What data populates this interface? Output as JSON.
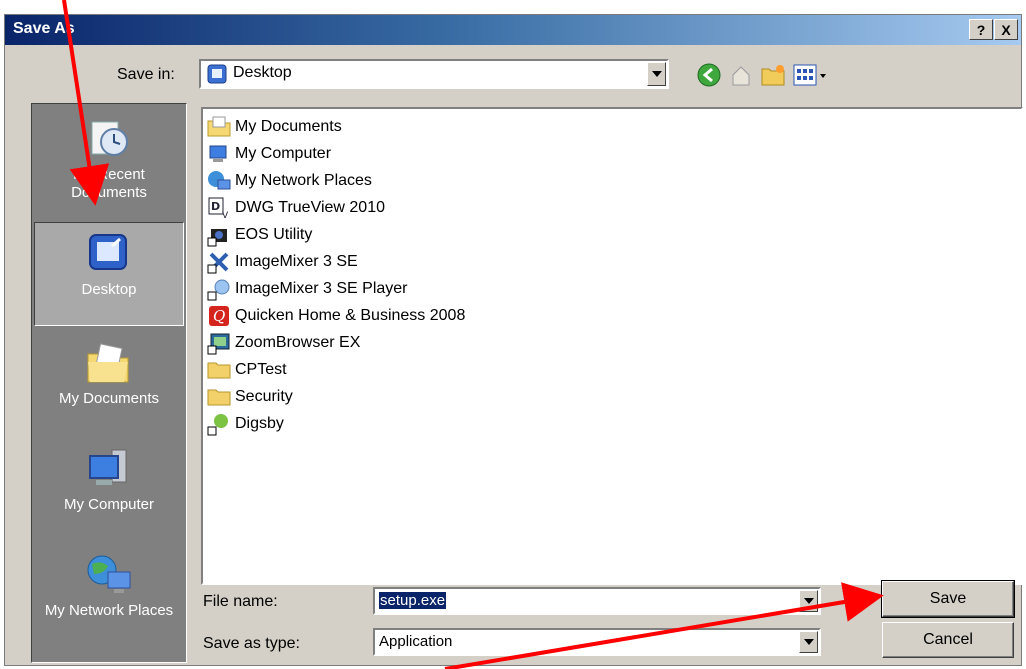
{
  "window": {
    "title": "Save As",
    "help_label": "?",
    "close_label": "X"
  },
  "save_in": {
    "label": "Save in:",
    "value": "Desktop"
  },
  "toolbar": {
    "icons": [
      "back-icon",
      "up-folder-icon",
      "new-folder-icon",
      "views-icon"
    ]
  },
  "places": [
    {
      "label": "My Recent Documents",
      "icon": "recent-documents-icon"
    },
    {
      "label": "Desktop",
      "icon": "desktop-icon",
      "selected": true
    },
    {
      "label": "My Documents",
      "icon": "my-documents-icon"
    },
    {
      "label": "My Computer",
      "icon": "my-computer-icon"
    },
    {
      "label": "My Network Places",
      "icon": "network-places-icon"
    }
  ],
  "files": [
    {
      "label": "My Documents",
      "icon": "my-documents-icon"
    },
    {
      "label": "My Computer",
      "icon": "my-computer-icon"
    },
    {
      "label": "My Network Places",
      "icon": "network-places-icon"
    },
    {
      "label": "DWG TrueView 2010",
      "icon": "shortcut-icon"
    },
    {
      "label": "EOS Utility",
      "icon": "shortcut-icon"
    },
    {
      "label": "ImageMixer 3 SE",
      "icon": "shortcut-icon"
    },
    {
      "label": "ImageMixer 3 SE Player",
      "icon": "shortcut-icon"
    },
    {
      "label": "Quicken Home & Business 2008",
      "icon": "shortcut-icon"
    },
    {
      "label": "ZoomBrowser EX",
      "icon": "shortcut-icon"
    },
    {
      "label": "CPTest",
      "icon": "folder-icon"
    },
    {
      "label": "Security",
      "icon": "folder-icon"
    },
    {
      "label": "Digsby",
      "icon": "shortcut-icon"
    }
  ],
  "file_name": {
    "label": "File name:",
    "value": "setup.exe"
  },
  "save_as_type": {
    "label": "Save as type:",
    "value": "Application"
  },
  "buttons": {
    "save": "Save",
    "cancel": "Cancel"
  },
  "colors": {
    "annotation_arrow": "#ff0000",
    "titlebar": "#0a246a",
    "selection": "#0a246a"
  }
}
